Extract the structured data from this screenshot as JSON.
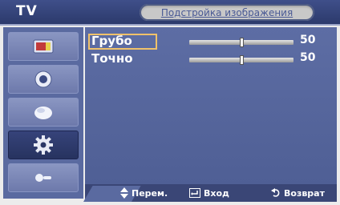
{
  "header": {
    "source_label": "TV",
    "title": "Подстройка изображения"
  },
  "sidebar": {
    "items": [
      {
        "icon": "picture-icon",
        "active": false
      },
      {
        "icon": "sound-icon",
        "active": false
      },
      {
        "icon": "channel-icon",
        "active": false
      },
      {
        "icon": "setup-gear-icon",
        "active": true
      },
      {
        "icon": "input-icon",
        "active": false
      }
    ]
  },
  "settings": [
    {
      "label": "Грубо",
      "value": "50",
      "level": 0.5,
      "selected": true
    },
    {
      "label": "Точно",
      "value": "50",
      "level": 0.5,
      "selected": false
    }
  ],
  "footer": {
    "move_label": "Перем.",
    "enter_label": "Вход",
    "return_label": "Возврат"
  },
  "colors": {
    "header": "#2f3d70",
    "panel": "#56669c",
    "selection": "#f0c26a",
    "text": "#ffffff"
  }
}
